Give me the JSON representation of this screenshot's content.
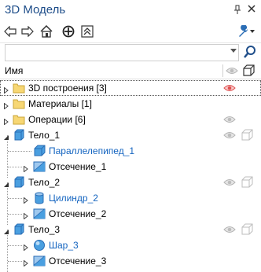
{
  "window": {
    "title": "3D Модель"
  },
  "titlebar_icons": [
    "pin-icon",
    "close-icon"
  ],
  "toolbar": {
    "buttons": [
      "back-arrow-icon",
      "forward-arrow-icon",
      "home-icon",
      "target-icon",
      "collapse-icon"
    ],
    "settings_icon": "wrench-icon"
  },
  "search": {
    "value": "",
    "placeholder": ""
  },
  "header": {
    "name_label": "Имя"
  },
  "tree": [
    {
      "label": "3D построения [3]",
      "icon": "folder-icon",
      "level": 0,
      "expander": "closed",
      "vis": "eye-red",
      "selected": true
    },
    {
      "label": "Материалы [1]",
      "icon": "folder-icon",
      "level": 0,
      "expander": "closed",
      "vis": "none"
    },
    {
      "label": "Операции [6]",
      "icon": "folder-icon",
      "level": 0,
      "expander": "closed",
      "vis": "eye"
    },
    {
      "label": "Тело_1",
      "icon": "body-cube-icon",
      "level": 0,
      "expander": "open",
      "vis": "eye-cube"
    },
    {
      "label": "Параллелепипед_1",
      "icon": "box-icon",
      "level": 1,
      "expander": "none",
      "vis": "none",
      "blue": true
    },
    {
      "label": "Отсечение_1",
      "icon": "cut-icon",
      "level": 1,
      "expander": "closed",
      "vis": "none"
    },
    {
      "label": "Тело_2",
      "icon": "body-cube-icon",
      "level": 0,
      "expander": "open",
      "vis": "eye-cube"
    },
    {
      "label": "Цилиндр_2",
      "icon": "cylinder-icon",
      "level": 1,
      "expander": "closed",
      "vis": "none",
      "blue": true
    },
    {
      "label": "Отсечение_2",
      "icon": "cut-icon",
      "level": 1,
      "expander": "closed",
      "vis": "none"
    },
    {
      "label": "Тело_3",
      "icon": "body-cube-icon",
      "level": 0,
      "expander": "open",
      "vis": "eye-cube"
    },
    {
      "label": "Шар_3",
      "icon": "sphere-icon",
      "level": 1,
      "expander": "closed",
      "vis": "none",
      "blue": true
    },
    {
      "label": "Отсечение_3",
      "icon": "cut-icon",
      "level": 1,
      "expander": "closed",
      "vis": "none"
    }
  ],
  "colors": {
    "title": "#1f4e8a",
    "link": "#1565c0",
    "folder": "#f7d774",
    "body": "#4a9fe0",
    "eye_red": "#e05050"
  }
}
